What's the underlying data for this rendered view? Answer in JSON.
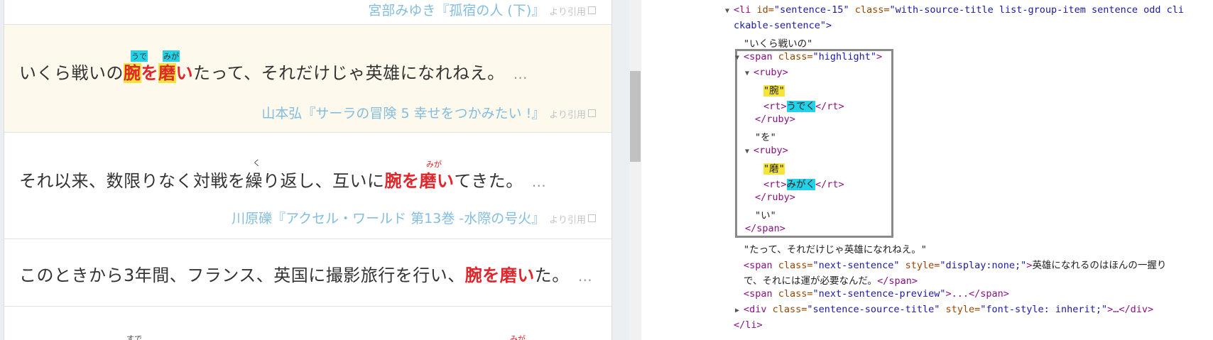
{
  "left_panel": {
    "top_source": "宮部みゆき『孤宿の人 (下)』",
    "yori": "より引用",
    "items": [
      {
        "pre": "いくら戦いの",
        "highlight_parts": [
          "腕",
          "を",
          "磨",
          "い"
        ],
        "post": "たって、それだけじゃ英雄になれねえ。",
        "ruby": [
          "うで",
          "みが"
        ],
        "dots": "…",
        "source": "山本弘『サーラの冒険 5 幸せをつかみたい !』"
      },
      {
        "pre": "それ以来、数限りなく対戦を繰り返し、互いに",
        "highlight": "腕を磨い",
        "post": "てきた。",
        "ruby_small": "く",
        "ruby": [
          "みが"
        ],
        "dots": "…",
        "source": "川原礫『アクセル・ワールド 第13巻 -水際の号火』"
      },
      {
        "pre": "このときから3年間、フランス、英国に撮影旅行を行い、",
        "highlight": "腕を磨い",
        "post": "た。",
        "dots": "…"
      },
      {
        "ruby_left": "すで",
        "ruby_right": "みが"
      }
    ]
  },
  "devtools": {
    "li_open": [
      "<li",
      " id=",
      "\"sentence-15\"",
      " class=",
      "\"with-source-title list-group-item sentence odd cli"
    ],
    "li_cont": "ckable-sentence\">",
    "text_pre": "\"いくら戦いの\"",
    "span_open": [
      "<span",
      " class=",
      "\"highlight\"",
      ">"
    ],
    "ruby_open": "<ruby>",
    "ruby_close": "</ruby>",
    "kanji1": "\"腕\"",
    "rt_open": "<rt>",
    "rt_close": "</rt>",
    "rt1_text": "うでく",
    "text_wo": "\"を\"",
    "kanji2": "\"磨\"",
    "rt2_text": "みがく",
    "text_i": "\"い\"",
    "span_close": "</span>",
    "text_post": "\"たって、それだけじゃ英雄になれねえ。\"",
    "next_sentence": [
      "<span",
      " class=",
      "\"next-sentence\"",
      " style=",
      "\"display:none;\"",
      ">",
      "英雄になれるのはほんの一握り"
    ],
    "next_sentence_cont": "で、それには運が必要なんだ。",
    "next_preview": [
      "<span",
      " class=",
      "\"next-sentence-preview\"",
      ">...</span>"
    ],
    "div_title": [
      "<div",
      " class=",
      "\"sentence-source-title\"",
      " style=",
      "\"font-style: inherit;\"",
      ">…</div>"
    ],
    "li_close": "</li>"
  }
}
